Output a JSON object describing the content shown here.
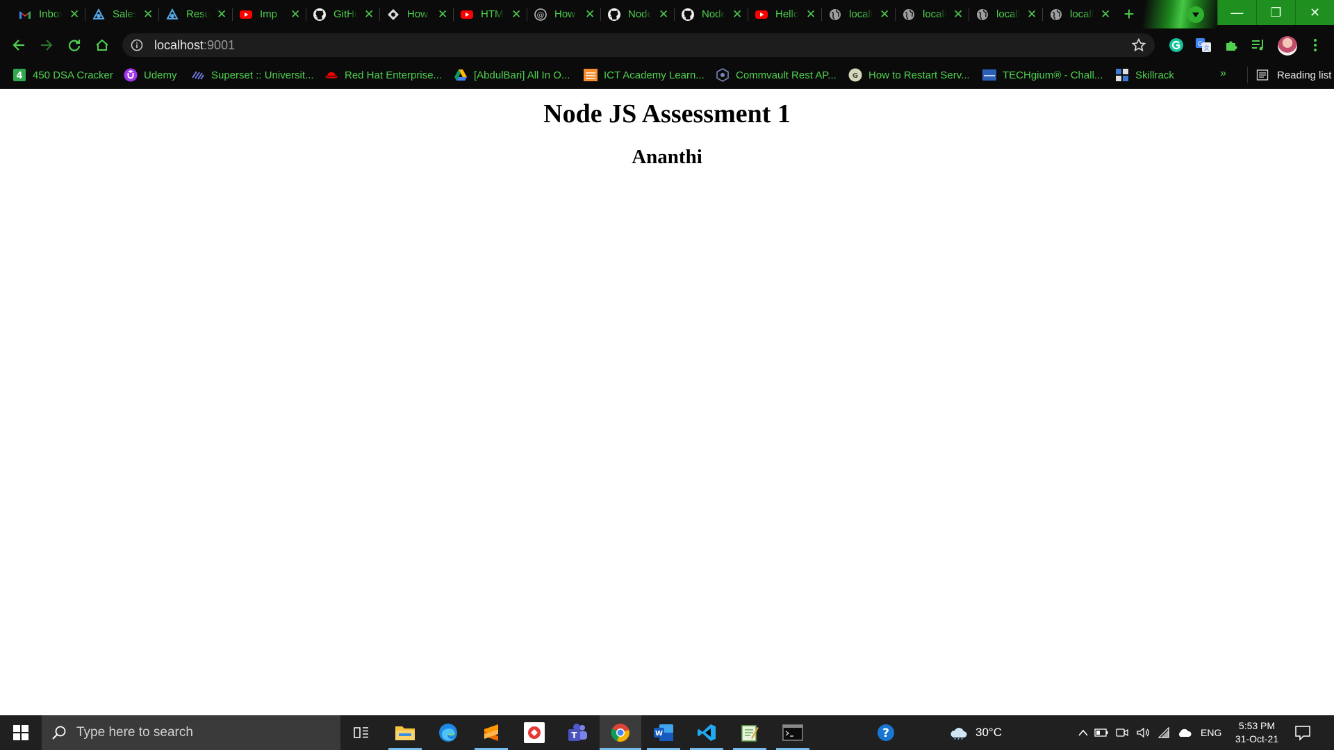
{
  "browser": {
    "tabs": [
      {
        "label": "Inbox",
        "icon": "gmail-icon"
      },
      {
        "label": "Sales",
        "icon": "cloud-icon"
      },
      {
        "label": "Results",
        "icon": "cloud-icon"
      },
      {
        "label": "Imp",
        "icon": "youtube-icon"
      },
      {
        "label": "GitHub",
        "icon": "github-icon"
      },
      {
        "label": "How",
        "icon": "hashnode-icon"
      },
      {
        "label": "HTML",
        "icon": "youtube-icon"
      },
      {
        "label": "How",
        "icon": "at-icon"
      },
      {
        "label": "Node",
        "icon": "github-icon"
      },
      {
        "label": "Node",
        "icon": "github-icon"
      },
      {
        "label": "Hello",
        "icon": "youtube-icon"
      },
      {
        "label": "localhost",
        "icon": "globe-icon"
      },
      {
        "label": "localhost",
        "icon": "globe-icon"
      },
      {
        "label": "localhost",
        "icon": "globe-icon"
      },
      {
        "label": "localhost",
        "icon": "globe-icon"
      }
    ],
    "tab_close": "✕",
    "new_tab": "+",
    "window_controls": {
      "minimize": "—",
      "restore": "❐",
      "close": "✕"
    },
    "address": {
      "host": "localhost",
      "port": ":9001"
    },
    "bookmarks": [
      {
        "label": "450 DSA Cracker",
        "icon": "four-icon"
      },
      {
        "label": "Udemy",
        "icon": "udemy-icon"
      },
      {
        "label": "Superset :: Universit...",
        "icon": "superset-icon"
      },
      {
        "label": "Red Hat Enterprise...",
        "icon": "redhat-icon"
      },
      {
        "label": "[AbdulBari] All In O...",
        "icon": "drive-icon"
      },
      {
        "label": "ICT Academy Learn...",
        "icon": "ict-icon"
      },
      {
        "label": "Commvault Rest AP...",
        "icon": "commvault-icon"
      },
      {
        "label": "How to Restart Serv...",
        "icon": "howto-icon"
      },
      {
        "label": "TECHgium® - Chall...",
        "icon": "techgium-icon"
      },
      {
        "label": "Skillrack",
        "icon": "skillrack-icon"
      }
    ],
    "bookmarks_overflow": "»",
    "reading_list": "Reading list"
  },
  "page": {
    "heading": "Node JS Assessment 1",
    "subheading": "Ananthi"
  },
  "taskbar": {
    "search_placeholder": "Type here to search",
    "weather": "30°C",
    "language": "ENG",
    "time": "5:53 PM",
    "date": "31-Oct-21"
  },
  "colors": {
    "tab_text": "#4fd14f",
    "accent_green": "#1f8f1f",
    "chrome_bg": "#0b0b0b",
    "taskbar_bg": "#202020"
  }
}
